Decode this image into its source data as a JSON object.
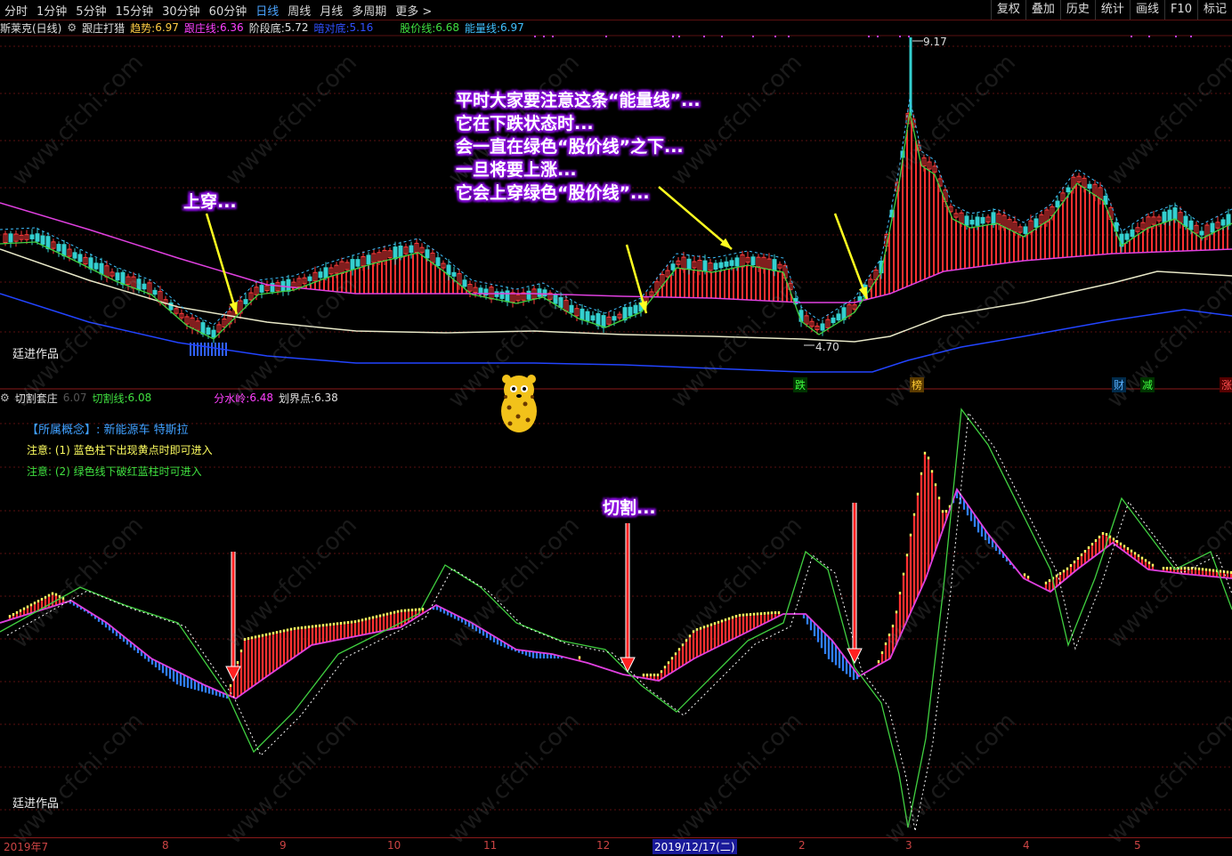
{
  "toolbar": {
    "timeframes": [
      "分时",
      "1分钟",
      "5分钟",
      "15分钟",
      "30分钟",
      "60分钟",
      "日线",
      "周线",
      "月线",
      "多周期",
      "更多 >"
    ],
    "active": "日线",
    "tools": [
      "复权",
      "叠加",
      "历史",
      "统计",
      "画线",
      "F10",
      "标记"
    ]
  },
  "main_legend": {
    "stock": "斯莱克(日线)",
    "indicator": "跟庄打猎",
    "trend_label": "趋势:",
    "trend_value": "6.97",
    "follow_label": "跟庄线:",
    "follow_value": "6.36",
    "stage_label": "阶段底:",
    "stage_value": "5.72",
    "cut_label": "暗对底:",
    "cut_value": "5.16",
    "price_label": "股价线:",
    "price_value": "6.68",
    "energy_label": "能量线:",
    "energy_value": "6.97"
  },
  "annotations": {
    "top_lines": [
      "平时大家要注意这条“能量线”...",
      "它在下跌状态时...",
      "会一直在绿色“股价线”之下...",
      "一旦将要上涨...",
      "它会上穿绿色“股价线”..."
    ],
    "cross": "上穿...",
    "cut": "切割..."
  },
  "price_marks": {
    "high": "9.17",
    "low": "4.70"
  },
  "watermark_author": "廷进作品",
  "signals": [
    "跌",
    "榜",
    "财",
    "减",
    "涨"
  ],
  "sub_legend": {
    "indicator": "切割套庄",
    "v1_label": "切割线:",
    "v1_value": "6.08",
    "v2_label": "分水岭:",
    "v2_value": "6.48",
    "v3_label": "划界点:",
    "v3_value": "6.38",
    "prefix_value": "6.07"
  },
  "concept": {
    "label": "【所属概念】:",
    "value": "新能源车 特斯拉"
  },
  "notes": [
    "注意: (1) 蓝色柱下出现黄点时即可进入",
    "注意: (2) 绿色线下破红蓝柱时可进入"
  ],
  "date_axis": {
    "labels": [
      "2019年7",
      "8",
      "9",
      "10",
      "11",
      "12",
      "2019/12/17(二)",
      "2",
      "3",
      "4",
      "5"
    ]
  },
  "watermark": "www.cfchi.com",
  "colors": {
    "up": "#ff3b3b",
    "down": "#34d0d0",
    "magenta": "#e040e0",
    "green": "#40d040",
    "yellow": "#ffff30",
    "blue": "#2244ff",
    "white": "#e8e8c8"
  }
}
